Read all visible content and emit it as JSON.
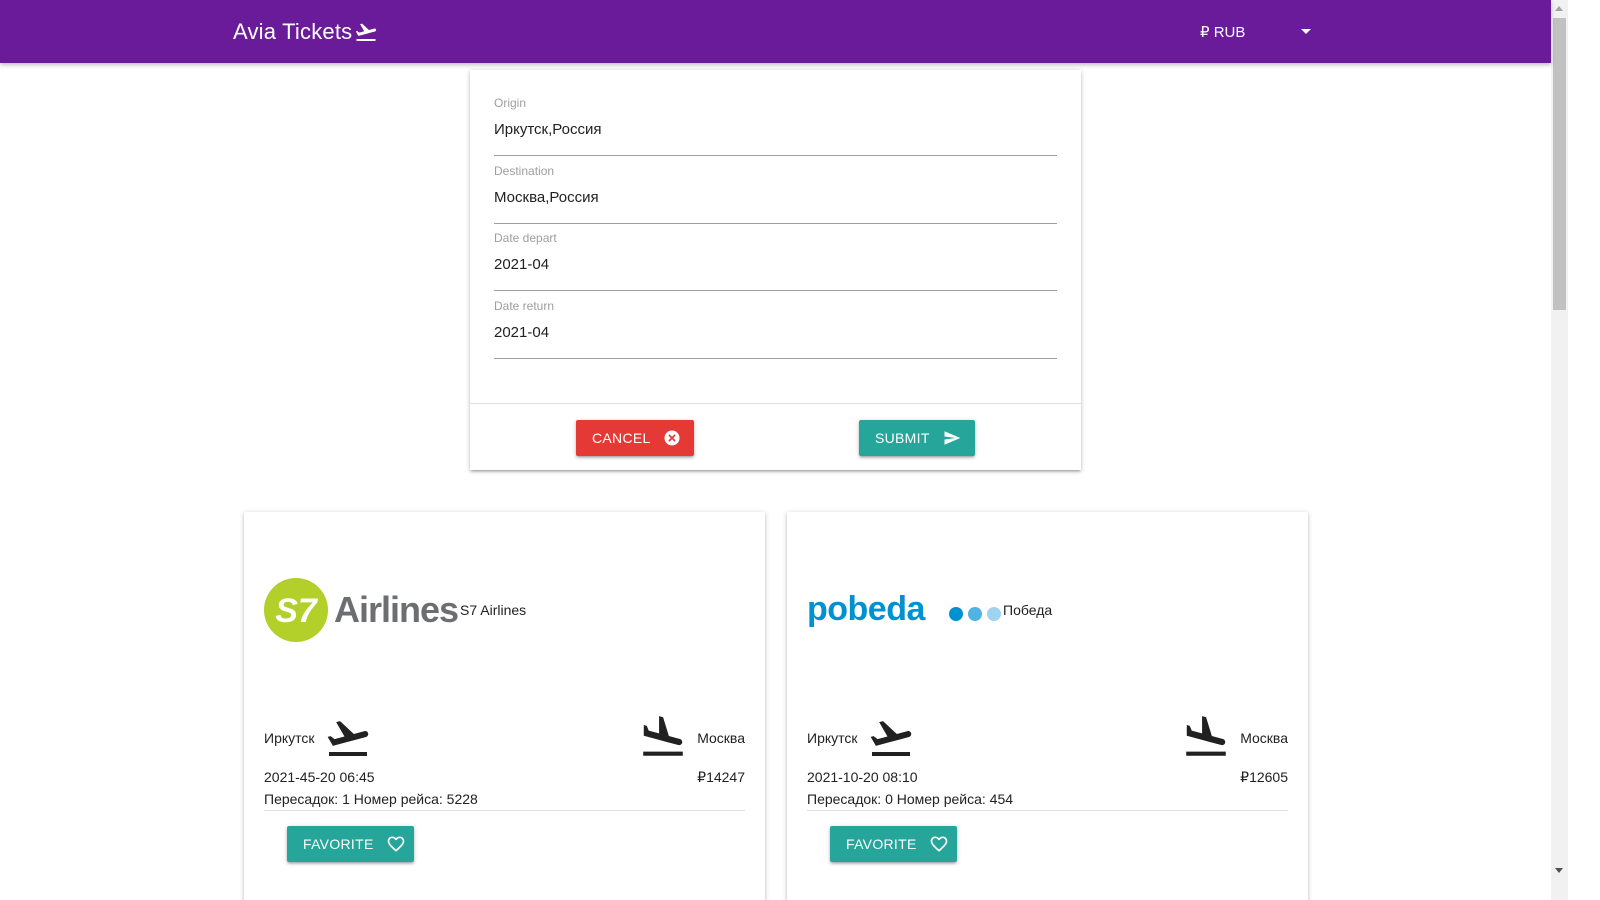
{
  "navbar": {
    "brand": "Avia Tickets",
    "currency": "₽ RUB"
  },
  "search": {
    "origin": {
      "label": "Origin",
      "value": "Иркутск,Россия"
    },
    "destination": {
      "label": "Destination",
      "value": "Москва,Россия"
    },
    "date_depart": {
      "label": "Date depart",
      "value": "2021-04"
    },
    "date_return": {
      "label": "Date return",
      "value": "2021-04"
    },
    "cancel_label": "Cancel",
    "submit_label": "Submit"
  },
  "tickets": [
    {
      "logo_text": "S7 Airlines",
      "logo_mark": "S7",
      "airline": "S7 Airlines",
      "origin": "Иркутск",
      "destination": "Москва",
      "departure": "2021-45-20 06:45",
      "price": "₽14247",
      "info": "Пересадок: 1 Номер рейса: 5228",
      "favorite_label": "Favorite"
    },
    {
      "logo_text": "pobeda",
      "airline": "Победа",
      "origin": "Иркутск",
      "destination": "Москва",
      "departure": "2021-10-20 08:10",
      "price": "₽12605",
      "info": "Пересадок: 0 Номер рейса: 454",
      "favorite_label": "Favorite"
    }
  ],
  "colors": {
    "primary": "#6a1b9a",
    "teal": "#26a69a",
    "red": "#e53935",
    "s7_green": "#b3cf29",
    "pobeda_blue": "#0091d0"
  }
}
